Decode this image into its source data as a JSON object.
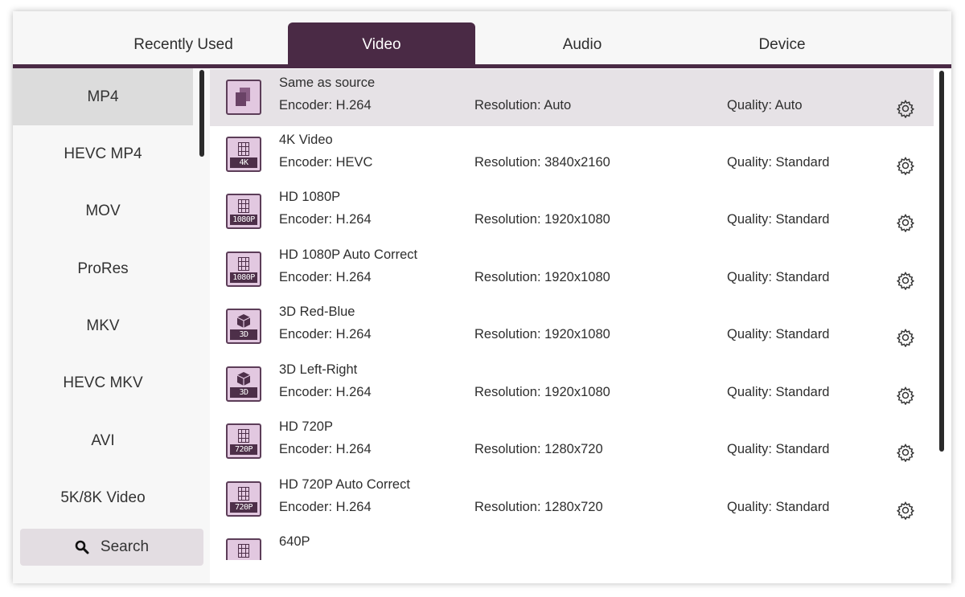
{
  "tabs": [
    {
      "label": "Recently Used"
    },
    {
      "label": "Video"
    },
    {
      "label": "Audio"
    },
    {
      "label": "Device"
    }
  ],
  "active_tab": "Video",
  "sidebar": {
    "items": [
      {
        "label": "MP4"
      },
      {
        "label": "HEVC MP4"
      },
      {
        "label": "MOV"
      },
      {
        "label": "ProRes"
      },
      {
        "label": "MKV"
      },
      {
        "label": "HEVC MKV"
      },
      {
        "label": "AVI"
      },
      {
        "label": "5K/8K Video"
      }
    ],
    "selected": "MP4",
    "search_label": "Search",
    "search_icon": "search-icon"
  },
  "formats": [
    {
      "title": "Same as source",
      "encoder": "Encoder: H.264",
      "resolution": "Resolution: Auto",
      "quality": "Quality: Auto",
      "icon": "copy-icon",
      "badge": ""
    },
    {
      "title": "4K Video",
      "encoder": "Encoder: HEVC",
      "resolution": "Resolution: 3840x2160",
      "quality": "Quality: Standard",
      "icon": "film-icon",
      "badge": "4K"
    },
    {
      "title": "HD 1080P",
      "encoder": "Encoder: H.264",
      "resolution": "Resolution: 1920x1080",
      "quality": "Quality: Standard",
      "icon": "film-icon",
      "badge": "1080P"
    },
    {
      "title": "HD 1080P Auto Correct",
      "encoder": "Encoder: H.264",
      "resolution": "Resolution: 1920x1080",
      "quality": "Quality: Standard",
      "icon": "film-icon",
      "badge": "1080P"
    },
    {
      "title": "3D Red-Blue",
      "encoder": "Encoder: H.264",
      "resolution": "Resolution: 1920x1080",
      "quality": "Quality: Standard",
      "icon": "cube-icon",
      "badge": "3D"
    },
    {
      "title": "3D Left-Right",
      "encoder": "Encoder: H.264",
      "resolution": "Resolution: 1920x1080",
      "quality": "Quality: Standard",
      "icon": "cube-icon",
      "badge": "3D"
    },
    {
      "title": "HD 720P",
      "encoder": "Encoder: H.264",
      "resolution": "Resolution: 1280x720",
      "quality": "Quality: Standard",
      "icon": "film-icon",
      "badge": "720P"
    },
    {
      "title": "HD 720P Auto Correct",
      "encoder": "Encoder: H.264",
      "resolution": "Resolution: 1280x720",
      "quality": "Quality: Standard",
      "icon": "film-icon",
      "badge": "720P"
    },
    {
      "title": "640P",
      "encoder": "",
      "resolution": "",
      "quality": "",
      "icon": "film-icon",
      "badge": ""
    }
  ],
  "colors": {
    "accent": "#4a2a45",
    "icon_fill": "#e2c8e0",
    "selected_row": "#e6e2e6",
    "sidebar_selected": "#dcdcdc"
  }
}
